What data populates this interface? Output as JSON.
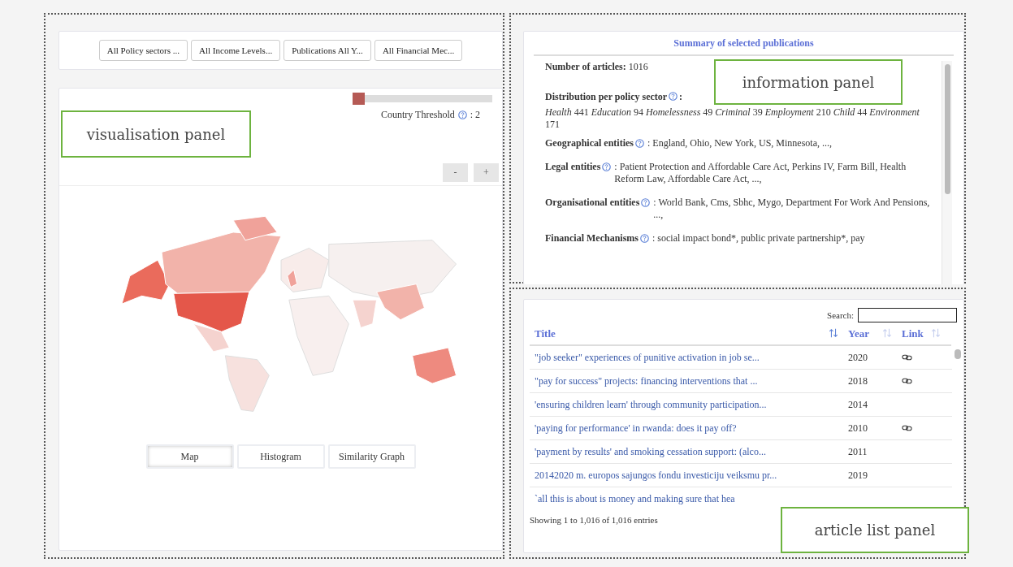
{
  "visualisation_panel": {
    "annotation": "visualisation panel",
    "filters": [
      "All Policy sectors ...",
      "All Income Levels...",
      "Publications All Y...",
      "All Financial Mec..."
    ],
    "threshold": {
      "label": "Country Threshold",
      "value": ": 2",
      "level": 0
    },
    "zoom_buttons": [
      "-",
      "+"
    ],
    "view_tabs": [
      {
        "label": "Map",
        "selected": true
      },
      {
        "label": "Histogram",
        "selected": false
      },
      {
        "label": "Similarity Graph",
        "selected": false
      }
    ]
  },
  "information_panel": {
    "annotation": "information panel",
    "title": "Summary of selected publications",
    "count": {
      "label": "Number of articles:",
      "value": "1016"
    },
    "distribution": {
      "label": "Distribution per policy sector",
      "separator": ":",
      "text": "*Health* 441 *Education* 94 *Homelessness* 49 *Criminal* 39 *Employment* 210 *Child* 44 *Environment* 171"
    },
    "entities": [
      {
        "label": "Geographical entities",
        "value": ": England, Ohio, New York, US, Minnesota, ...,"
      },
      {
        "label": "Legal entities",
        "value": ": Patient Protection and Affordable Care Act, Perkins IV, Farm Bill, Health Reform Law, Affordable Care Act, ...,"
      },
      {
        "label": "Organisational entities",
        "value": ": World Bank, Cms, Sbhc, Mygo, Department For Work And Pensions, ...,"
      },
      {
        "label": "Financial Mechanisms",
        "value": ": social impact bond*, public private partnership*, pay"
      }
    ]
  },
  "article_list_panel": {
    "annotation": "article list panel",
    "search": {
      "label": "Search:"
    },
    "columns": [
      "Title",
      "Year",
      "Link"
    ],
    "rows": [
      {
        "title": "\"job seeker\" experiences of punitive activation in job se...",
        "year": "2020",
        "has_link": true
      },
      {
        "title": "\"pay for success\" projects: financing interventions that ...",
        "year": "2018",
        "has_link": true
      },
      {
        "title": "'ensuring children learn' through community participation...",
        "year": "2014",
        "has_link": false
      },
      {
        "title": "'paying for performance' in rwanda: does it pay off?",
        "year": "2010",
        "has_link": true
      },
      {
        "title": "'payment by results' and smoking cessation support: (alco...",
        "year": "2011",
        "has_link": false
      },
      {
        "title": "20142020 m. europos sajungos fondu investiciju veiksmu pr...",
        "year": "2019",
        "has_link": false
      },
      {
        "title": "`all this is about is money and making sure that hea"
      }
    ],
    "footer": "Showing 1 to 1,016 of 1,016 entries"
  }
}
